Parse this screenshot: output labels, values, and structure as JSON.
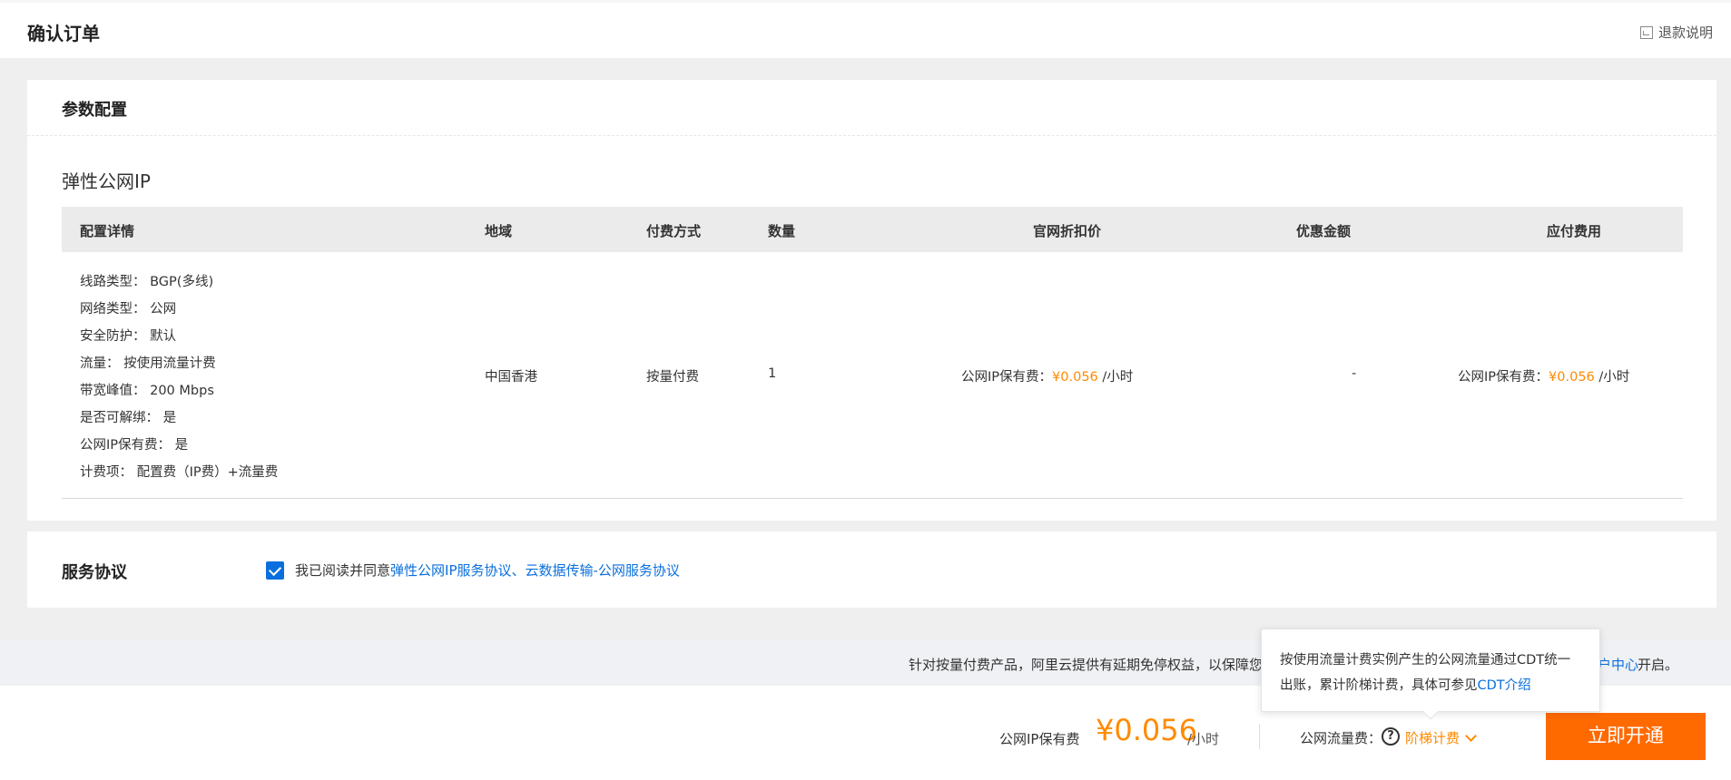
{
  "header": {
    "title": "确认订单",
    "refund_label": "退款说明"
  },
  "params": {
    "title": "参数配置",
    "product_name": "弹性公网IP",
    "columns": [
      "配置详情",
      "地域",
      "付费方式",
      "数量",
      "官网折扣价",
      "优惠金额",
      "应付费用"
    ],
    "specs": [
      "线路类型： BGP(多线)",
      "网络类型： 公网",
      "安全防护： 默认",
      "流量： 按使用流量计费",
      "带宽峰值： 200 Mbps",
      "是否可解绑： 是",
      "公网IP保有费： 是",
      "计费项： 配置费（IP费）+流量费"
    ],
    "region": "中国香港",
    "payment": "按量付费",
    "quantity": "1",
    "list_price_label": "公网IP保有费：",
    "list_price_value": "¥0.056",
    "list_price_unit": " /小时",
    "discount": "-",
    "due_label": "公网IP保有费：",
    "due_value": "¥0.056",
    "due_unit": " /小时"
  },
  "service": {
    "title": "服务协议",
    "agree_prefix": "我已阅读并同意",
    "agree_links": "弹性公网IP服务协议、云数据传输-公网服务协议",
    "checked": true
  },
  "notice": {
    "text": "针对按量付费产品，阿里云提供有延期免停权益，以保障您",
    "link": "户中心",
    "tail": "开启。"
  },
  "tooltip": {
    "text": "按使用流量计费实例产生的公网流量通过CDT统一出账，累计阶梯计费，具体可参见",
    "link": "CDT介绍"
  },
  "footer": {
    "fee_label": "公网IP保有费",
    "fee_amount": "¥0.056",
    "fee_unit": "/小时",
    "traffic_label": "公网流量费：",
    "tier_label": "阶梯计费",
    "open_button": "立即开通"
  },
  "colors": {
    "accent_orange": "#ff8a00",
    "button_orange": "#ff6a00",
    "link_blue": "#0a6fdc"
  }
}
